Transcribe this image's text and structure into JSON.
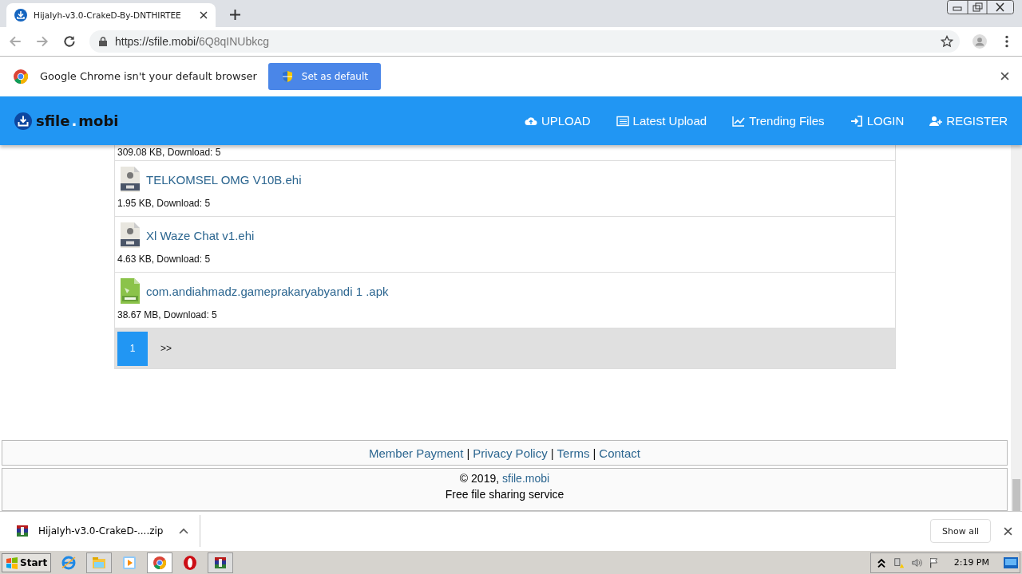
{
  "browser": {
    "tab": {
      "title": "HijaIyh-v3.0-CrakeD-By-DNTHIRTEE",
      "selected": true
    },
    "url_host": "https://sfile.mobi/",
    "url_path": "6Q8qINUbkcg"
  },
  "infobar": {
    "message": "Google Chrome isn't your default browser",
    "button": "Set as default"
  },
  "site": {
    "logo_bold": "sfile",
    "logo_dot": ".",
    "logo_rest": "mobi",
    "nav": [
      "UPLOAD",
      "Latest Upload",
      "Trending Files",
      "LOGIN",
      "REGISTER"
    ]
  },
  "files": [
    {
      "kind": "partial",
      "meta": "309.08 KB, Download: 5"
    },
    {
      "kind": "ehi",
      "name": "TELKOMSEL OMG V10B.ehi",
      "meta": "1.95 KB, Download: 5"
    },
    {
      "kind": "ehi",
      "name": "Xl Waze Chat v1.ehi",
      "meta": "4.63 KB, Download: 5"
    },
    {
      "kind": "apk",
      "name": "com.andiahmadz.gameprakaryabyandi 1 .apk",
      "meta": "38.67 MB, Download: 5"
    }
  ],
  "pagination": [
    {
      "label": "1",
      "selected": true
    },
    {
      "label": ">>",
      "selected": false
    }
  ],
  "footer": {
    "links": [
      "Member Payment",
      "Privacy Policy",
      "Terms",
      "Contact"
    ],
    "separator": "|",
    "copyright": "© 2019,",
    "site_link": "sfile.mobi",
    "tagline": "Free file sharing service"
  },
  "download_bar": {
    "file": "HijaIyh-v3.0-CrakeD-....zip",
    "show_all": "Show all"
  },
  "taskbar": {
    "start": "Start",
    "clock": "2:19 PM"
  }
}
